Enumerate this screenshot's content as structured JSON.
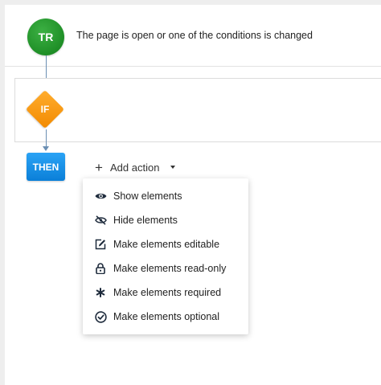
{
  "trigger": {
    "node_label": "TR",
    "text": "The page is open or one of the conditions is changed"
  },
  "condition": {
    "node_label": "IF"
  },
  "action": {
    "node_label": "THEN",
    "add_action_label": "Add action"
  },
  "menu": {
    "items": [
      {
        "label": "Show elements",
        "icon": "eye-icon"
      },
      {
        "label": "Hide elements",
        "icon": "eye-slash-icon"
      },
      {
        "label": "Make elements editable",
        "icon": "edit-icon"
      },
      {
        "label": "Make elements read-only",
        "icon": "lock-icon"
      },
      {
        "label": "Make elements required",
        "icon": "asterisk-icon"
      },
      {
        "label": "Make elements optional",
        "icon": "check-circle-icon"
      }
    ]
  },
  "colors": {
    "trigger_green": "#1f8f27",
    "condition_orange": "#f28a00",
    "action_blue": "#0b7fd8",
    "connector": "#6b8fb3"
  }
}
